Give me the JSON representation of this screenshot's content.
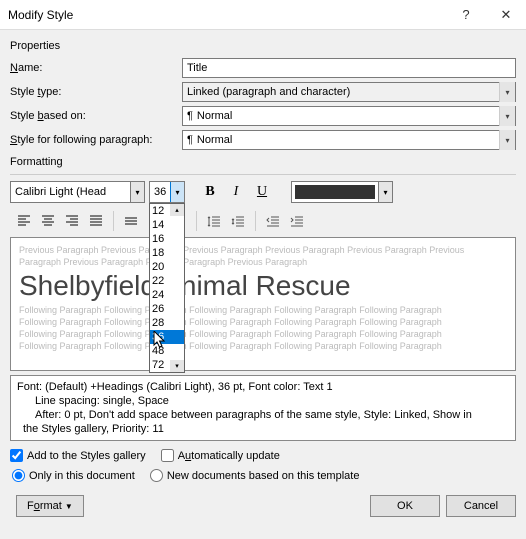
{
  "titlebar": {
    "title": "Modify Style"
  },
  "sections": {
    "properties": "Properties",
    "formatting": "Formatting"
  },
  "props": {
    "name_label": "Name:",
    "name_value": "Title",
    "type_label": "Style type:",
    "type_value": "Linked (paragraph and character)",
    "based_label_pre": "Style ",
    "based_label_key": "b",
    "based_label_post": "ased on:",
    "based_value": "Normal",
    "following_label_pre": "",
    "following_label_key": "S",
    "following_label_post": "tyle for following paragraph:",
    "following_value": "Normal",
    "pilcrow": "¶"
  },
  "formatting": {
    "font_name": "Calibri Light (Head",
    "font_size": "36",
    "size_options": [
      "12",
      "14",
      "16",
      "18",
      "20",
      "22",
      "24",
      "26",
      "28",
      "36",
      "48",
      "72"
    ],
    "size_selected": "36",
    "size_under_cursor": "48"
  },
  "preview": {
    "gray_before_1": "Previous Paragraph Previous Paragraph Previous Paragraph Previous Paragraph Previous Paragraph Previous",
    "gray_before_2": "Paragraph Previous Paragraph Previous Paragraph Previous Paragraph",
    "title_text": "Shelbyfield Animal Rescue",
    "gray_after_1": "Following Paragraph Following Paragraph Following Paragraph Following Paragraph Following Paragraph",
    "gray_after_2": "Following Paragraph Following Paragraph Following Paragraph Following Paragraph Following Paragraph",
    "gray_after_3": "Following Paragraph Following Paragraph Following Paragraph Following Paragraph Following Paragraph",
    "gray_after_4": "Following Paragraph Following Paragraph Following Paragraph Following Paragraph Following Paragraph"
  },
  "description": {
    "line1": "Font: (Default) +Headings (Calibri Light), 36 pt, Font color: Text 1",
    "line2": "Line spacing:  single, Space",
    "line3": "After:  0 pt, Don't add space between paragraphs of the same style, Style: Linked, Show in",
    "line4": "the Styles gallery, Priority: 11"
  },
  "checks": {
    "add_gallery": "Add to the Styles gallery",
    "auto_update": "Automatically update"
  },
  "radios": {
    "only_doc": "Only in this document",
    "new_docs": "New documents based on this template"
  },
  "buttons": {
    "format": "Format",
    "ok": "OK",
    "cancel": "Cancel"
  }
}
